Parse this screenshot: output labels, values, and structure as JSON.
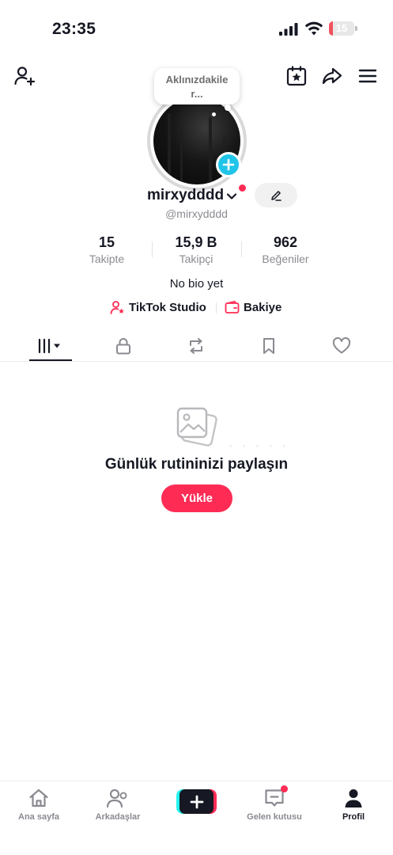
{
  "status_bar": {
    "time": "23:35",
    "battery_percent": "15",
    "battery_level": 0.15,
    "battery_color": "#f1525e"
  },
  "top_bar": {
    "add_friend_icon": "person-plus-icon",
    "calendar_icon": "calendar-star-icon",
    "share_icon": "share-arrow-icon",
    "menu_icon": "hamburger-menu-icon"
  },
  "profile": {
    "note_line1": "Aklınızdakile",
    "note_line2": "r...",
    "username": "mirxydddd",
    "handle": "@mirxydddd",
    "bio": "No bio yet"
  },
  "stats": [
    {
      "value": "15",
      "label": "Takipte"
    },
    {
      "value": "15,9 B",
      "label": "Takipçi"
    },
    {
      "value": "962",
      "label": "Beğeniler"
    }
  ],
  "links": {
    "studio": "TikTok Studio",
    "wallet": "Bakiye"
  },
  "tabs": [
    "videos-grid-icon",
    "lock-icon",
    "repost-icon",
    "bookmark-icon",
    "heart-icon"
  ],
  "empty_state": {
    "title": "Günlük rutininizi paylaşın",
    "button": "Yükle"
  },
  "bottom_nav": {
    "home": "Ana sayfa",
    "friends": "Arkadaşlar",
    "inbox": "Gelen kutusu",
    "profile": "Profil"
  },
  "colors": {
    "accent": "#fe2c55",
    "cyan": "#25f4ee",
    "avatar_badge": "#20c4e8",
    "text": "#161823",
    "muted": "#8a8b91"
  }
}
